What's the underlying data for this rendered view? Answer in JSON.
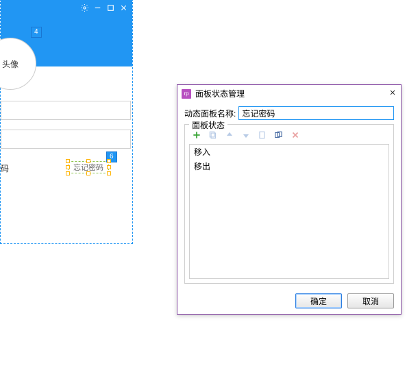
{
  "design": {
    "avatar_label": "头像",
    "badge4": "4",
    "badge6": "6",
    "bottom_left": "码",
    "forgot_label": "忘记密码"
  },
  "dialog": {
    "app_icon_text": "rp",
    "title": "面板状态管理",
    "name_label": "动态面板名称:",
    "name_value": "忘记密码",
    "fieldset_legend": "面板状态",
    "states": [
      "移入",
      "移出"
    ],
    "ok_label": "确定",
    "cancel_label": "取消"
  }
}
